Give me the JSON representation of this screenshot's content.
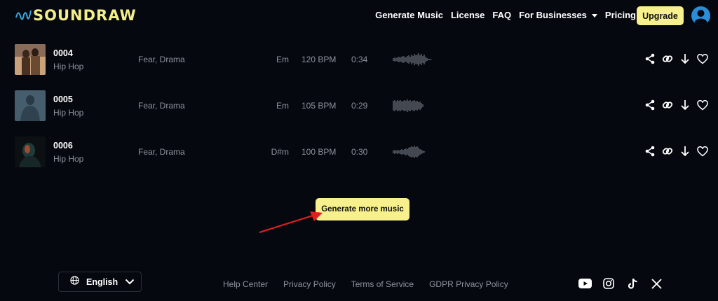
{
  "header": {
    "logo_text": "SOUNDRAW",
    "nav": [
      "Generate Music",
      "License",
      "FAQ",
      "For Businesses",
      "Pricing"
    ],
    "upgrade_label": "Upgrade"
  },
  "tracks": [
    {
      "id": "0004",
      "genre": "Hip Hop",
      "moods": "Fear, Drama",
      "key": "Em",
      "bpm": "120 BPM",
      "duration": "0:34"
    },
    {
      "id": "0005",
      "genre": "Hip Hop",
      "moods": "Fear, Drama",
      "key": "Em",
      "bpm": "105 BPM",
      "duration": "0:29"
    },
    {
      "id": "0006",
      "genre": "Hip Hop",
      "moods": "Fear, Drama",
      "key": "D#m",
      "bpm": "100 BPM",
      "duration": "0:30"
    }
  ],
  "track_action_icons": [
    "share-icon",
    "link-icon",
    "download-icon",
    "heart-icon"
  ],
  "cta_label": "Generate more music",
  "footer": {
    "language": "English",
    "links": [
      "Help Center",
      "Privacy Policy",
      "Terms of Service",
      "GDPR Privacy Policy"
    ],
    "socials": [
      "youtube-icon",
      "instagram-icon",
      "tiktok-icon",
      "x-icon"
    ]
  },
  "colors": {
    "background": "#05080f",
    "accent": "#f7f08c",
    "muted_text": "#8e939c",
    "avatar": "#2a8dd8",
    "annotation_arrow": "#e02020"
  }
}
